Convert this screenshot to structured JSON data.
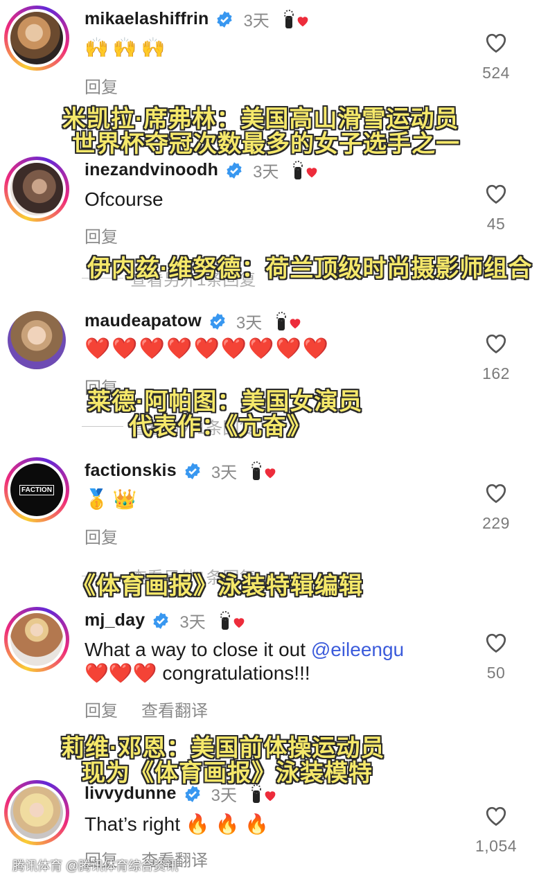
{
  "comments": [
    {
      "username": "mikaelashiffrin",
      "time": "3天",
      "text": "",
      "emoji": [
        "🙌",
        "🙌",
        "🙌"
      ],
      "actions": [
        "回复"
      ],
      "likes": "524"
    },
    {
      "username": "inezandvinoodh",
      "time": "3天",
      "text": "Ofcourse",
      "actions": [
        "回复"
      ],
      "likes": "45",
      "view_more": "查看另外1条回复"
    },
    {
      "username": "maudeapatow",
      "time": "3天",
      "text": "",
      "emoji": [
        "❤️",
        "❤️",
        "❤️",
        "❤️",
        "❤️",
        "❤️",
        "❤️",
        "❤️",
        "❤️"
      ],
      "actions": [
        "回复"
      ],
      "likes": "162",
      "view_more": "查看另外1条回复"
    },
    {
      "username": "factionskis",
      "time": "3天",
      "text": "",
      "emoji": [
        "🥇",
        "👑"
      ],
      "avatar_text": "FACTION",
      "actions": [
        "回复"
      ],
      "likes": "229",
      "view_more": "查看另外1条回复"
    },
    {
      "username": "mj_day",
      "time": "3天",
      "text_line1": "What a way to close it out ",
      "mention": "@eileengu",
      "text_line2": " congratulations!!!",
      "emoji_line2": [
        "❤️",
        "❤️",
        "❤️"
      ],
      "actions": [
        "回复",
        "查看翻译"
      ],
      "likes": "50"
    },
    {
      "username": "livvydunne",
      "time": "3天",
      "text": "That’s right ",
      "emoji": [
        "🔥",
        "🔥",
        "🔥"
      ],
      "actions": [
        "回复",
        "查看翻译"
      ],
      "likes": "1,054"
    }
  ],
  "overlays": [
    "米凯拉·席弗林：美国高山滑雪运动员",
    "世界杯夺冠次数最多的女子选手之一",
    "伊内兹·维努德：荷兰顶级时尚摄影师组合",
    "莱德·阿帕图：美国女演员",
    "代表作：《亢奋》",
    "《体育画报》泳装特辑编辑",
    "莉维·邓恩：美国前体操运动员",
    "现为《体育画报》泳装模特"
  ],
  "watermark": "腾讯体育 @腾讯体育综合资讯",
  "colors": {
    "verified": "#3897f0",
    "heart": "#ed2c3b",
    "overlay_text": "#f5e86a",
    "mention": "#3b5bdb"
  },
  "icons": {
    "verified": "verified-badge-icon",
    "like": "heart-outline-icon",
    "liked_by_author": "creator-liked-icon"
  }
}
